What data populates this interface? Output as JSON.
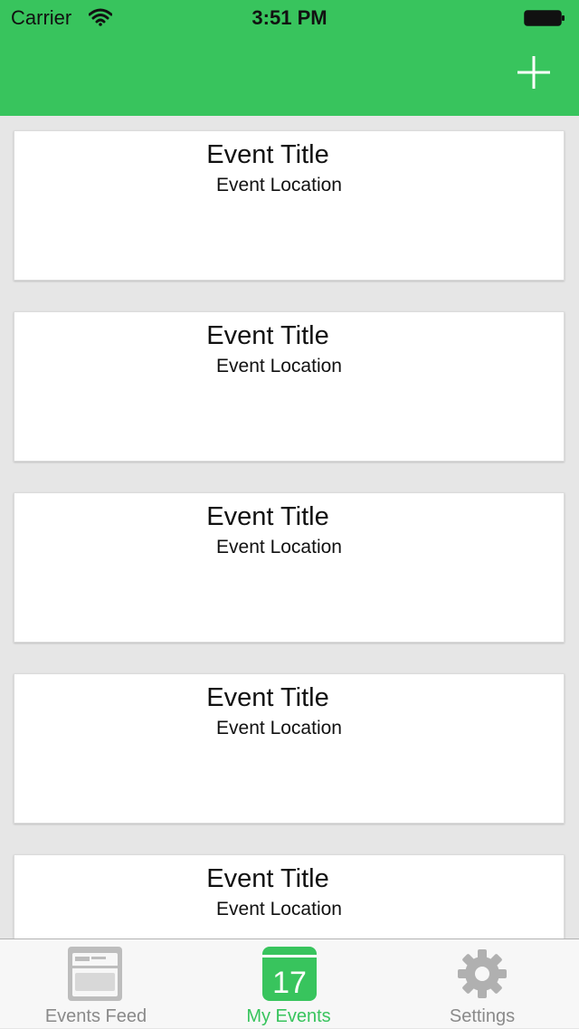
{
  "status_bar": {
    "carrier": "Carrier",
    "time": "3:51 PM"
  },
  "header": {
    "add_icon": "plus-icon",
    "accent_color": "#38c45d"
  },
  "events": [
    {
      "title": "Event Title",
      "location": "Event Location"
    },
    {
      "title": "Event Title",
      "location": "Event Location"
    },
    {
      "title": "Event Title",
      "location": "Event Location"
    },
    {
      "title": "Event Title",
      "location": "Event Location"
    },
    {
      "title": "Event Title",
      "location": "Event Location"
    }
  ],
  "tabbar": {
    "tabs": [
      {
        "label": "Events Feed",
        "icon": "newsfeed-icon",
        "active": false
      },
      {
        "label": "My Events",
        "icon": "calendar-icon",
        "active": true,
        "icon_text": "17"
      },
      {
        "label": "Settings",
        "icon": "gear-icon",
        "active": false
      }
    ]
  }
}
